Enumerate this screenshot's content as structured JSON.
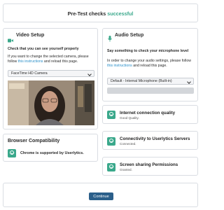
{
  "header": {
    "title_prefix": "Pre-Test checks",
    "title_status": "successful"
  },
  "video": {
    "title": "Video Setup",
    "instruction": "Check that you can see yourself properly",
    "help_prefix": "If you want to change the selected camera, please follow ",
    "help_link": "this instructions",
    "help_suffix": " and reload this page.",
    "camera_selected": "FaceTime HD Camera"
  },
  "audio": {
    "title": "Audio Setup",
    "instruction": "Say something to check your microphone level",
    "help_prefix": "In order to change your audio settings, please follow ",
    "help_link": "this instructions",
    "help_suffix": " and reload this page.",
    "microphone_selected": "Default - Internal Microphone (Built-in)"
  },
  "browser": {
    "title": "Browser Compatibility",
    "status": "Chrome is supported by Userlytics."
  },
  "checks": [
    {
      "title": "Internet connection quality",
      "status": "Good Quality."
    },
    {
      "title": "Connectivity to Userlytics Servers",
      "status": "Connected."
    },
    {
      "title": "Screen sharing Permissions",
      "status": "Granted."
    }
  ],
  "footer": {
    "continue_label": "Continue"
  },
  "colors": {
    "accent": "#3aa88b",
    "link": "#2a8fc9",
    "button": "#2b5f8a"
  }
}
